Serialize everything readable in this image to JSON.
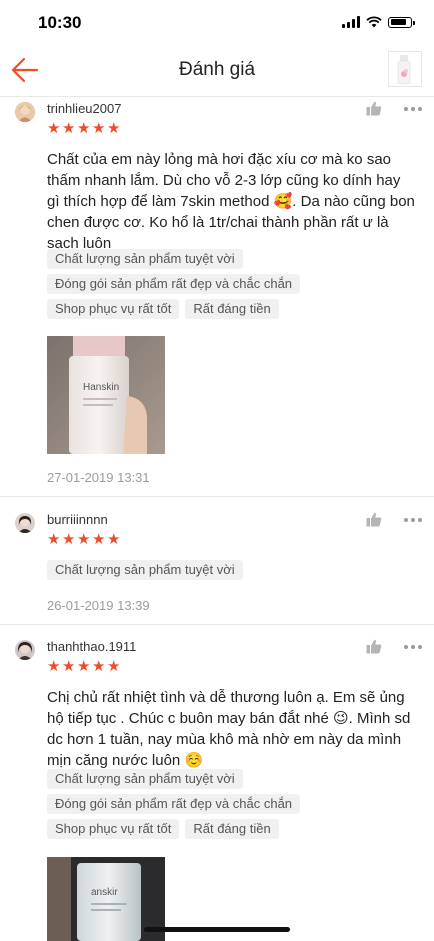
{
  "status_bar": {
    "time": "10:30"
  },
  "header": {
    "title": "Đánh giá"
  },
  "reviews": [
    {
      "username": "trinhlieu2007",
      "rating": 5,
      "comment": "Chất của em này lỏng mà hơi đặc xíu cơ mà ko sao thấm nhanh lắm. Dù cho vỗ 2-3 lớp cũng ko dính hay gì thích hợp để làm 7skin method 🥰. Da nào cũng bon chen được cơ. Ko hổ là 1tr/chai thành phần rất ư là sạch luôn",
      "tags": [
        "Chất lượng sản phẩm tuyệt vời",
        "Đóng gói sản phẩm rất đẹp và chắc chắn",
        "Shop phục vụ rất tốt",
        "Rất đáng tiền"
      ],
      "photo_text": "Hanskin",
      "date": "27-01-2019 13:31"
    },
    {
      "username": "burriiinnnn",
      "rating": 5,
      "tags": [
        "Chất lượng sản phẩm tuyệt vời"
      ],
      "date": "26-01-2019 13:39"
    },
    {
      "username": "thanhthao.1911",
      "rating": 5,
      "comment": "Chị chủ rất nhiệt tình và dễ thương luôn ạ. Em sẽ ủng hộ tiếp tục . Chúc c buôn may bán đắt nhé 😉. Mình sd dc hơn 1 tuần, nay mùa khô mà nhờ em này da mình mịn căng nước luôn ☺️",
      "tags": [
        "Chất lượng sản phẩm tuyệt vời",
        "Đóng gói sản phẩm rất đẹp và chắc chắn",
        "Shop phục vụ rất tốt",
        "Rất đáng tiền"
      ],
      "photo_text": "anskir"
    }
  ],
  "colors": {
    "accent": "#ee4d2d",
    "tag_bg": "#f0f0f0",
    "divider": "#e8e8e8"
  },
  "icons": {
    "back": "arrow-left-icon",
    "like": "thumbs-up-icon",
    "more": "more-dots-icon",
    "star": "star-icon"
  }
}
